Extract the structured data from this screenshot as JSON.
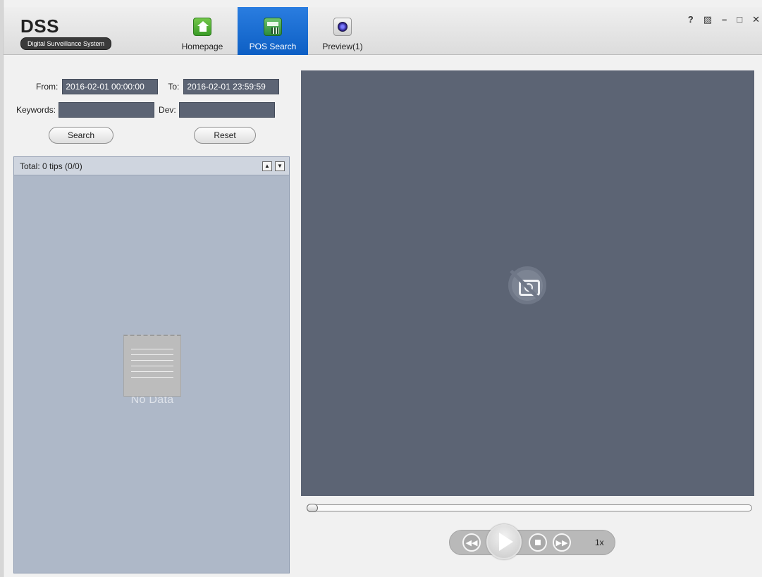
{
  "app": {
    "logo_title": "DSS",
    "logo_subtitle": "Digital Surveillance System"
  },
  "nav": {
    "tabs": [
      {
        "label": "Homepage",
        "icon": "home-icon",
        "active": false
      },
      {
        "label": "POS Search",
        "icon": "pos-icon",
        "active": true
      },
      {
        "label": "Preview(1)",
        "icon": "camera-lens-icon",
        "active": false
      }
    ],
    "accent_color": "#0d5fc4"
  },
  "window_controls": {
    "help": "?",
    "lock": "🔒",
    "minimize": "–",
    "maximize": "□",
    "close": "✕"
  },
  "search": {
    "from_label": "From:",
    "from_value": "2016-02-01 00:00:00",
    "to_label": "To:",
    "to_value": "2016-02-01 23:59:59",
    "keywords_label": "Keywords:",
    "keywords_value": "",
    "dev_label": "Dev:",
    "dev_value": "",
    "search_button": "Search",
    "reset_button": "Reset"
  },
  "results": {
    "total_text": "Total: 0 tips (0/0)",
    "up_arrow": "▲",
    "down_arrow": "▼",
    "empty_text": "No Data"
  },
  "player": {
    "video_bg_color": "#5c6474",
    "no_video_icon": "camera-off-icon",
    "progress": 0,
    "speed": "1x"
  }
}
